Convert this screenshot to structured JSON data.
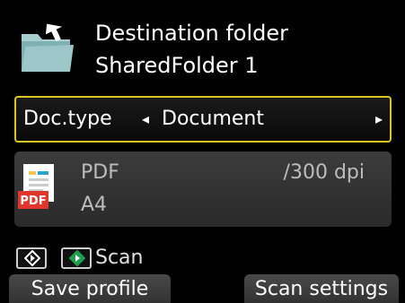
{
  "destination": {
    "title": "Destination folder",
    "folder": "SharedFolder 1",
    "icon": "folder-upload-icon"
  },
  "doc_type": {
    "label": "Doc.type",
    "value": "Document",
    "left_icon": "arrow-left-icon",
    "right_icon": "arrow-right-icon",
    "highlight_color": "#d9c420"
  },
  "format": {
    "icon": "pdf-icon",
    "type": "PDF",
    "resolution": "/300 dpi",
    "size": "A4"
  },
  "start_keys": {
    "mono_icon": "black-start-icon",
    "color_icon": "color-start-icon",
    "label": "Scan"
  },
  "buttons": {
    "save_profile": "Save profile",
    "scan_settings": "Scan settings"
  }
}
